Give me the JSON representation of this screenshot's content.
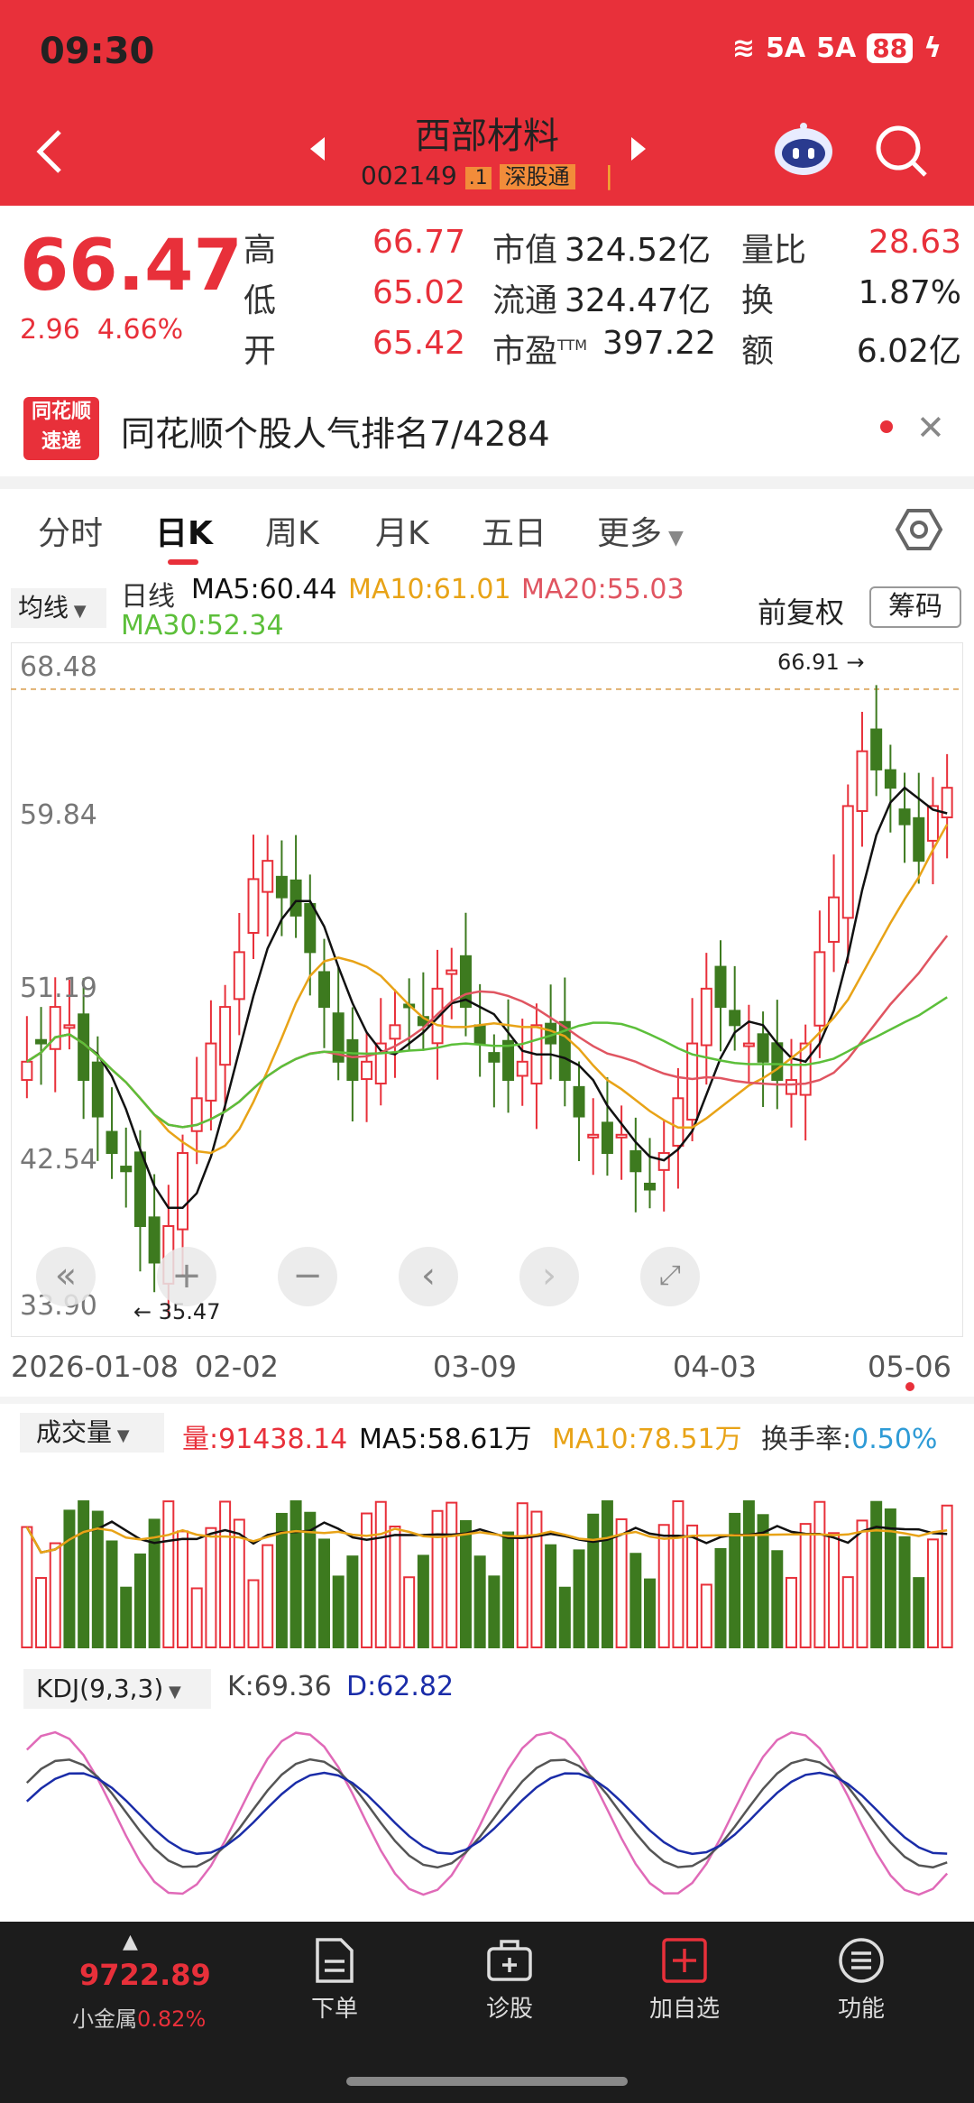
{
  "status": {
    "time": "09:30",
    "signal": "5A",
    "battery": "88"
  },
  "header": {
    "name": "西部材料",
    "code": "002149",
    "tag_level": ".1",
    "tag_exchange": "深股通"
  },
  "quote": {
    "price": "66.47",
    "change": "2.96",
    "change_pct": "4.66%",
    "high_label": "高",
    "high": "66.77",
    "low_label": "低",
    "low": "65.02",
    "open_label": "开",
    "open": "65.42",
    "mcap_label": "市值",
    "mcap": "324.52亿",
    "float_label": "流通",
    "float": "324.47亿",
    "pe_label": "市盈",
    "pe_sup": "TTM",
    "pe": "397.22",
    "vr_label": "量比",
    "vr": "28.63",
    "turnover_label": "换",
    "turnover": "1.87%",
    "amount_label": "额",
    "amount": "6.02亿"
  },
  "banner": {
    "logo_top": "同花顺",
    "logo_bottom": "速递",
    "text": "同花顺个股人气排名7/4284"
  },
  "tabs": [
    "分时",
    "日K",
    "周K",
    "月K",
    "五日",
    "更多"
  ],
  "kline": {
    "ma_select": "均线",
    "period": "日线",
    "ma5": "MA5:60.44",
    "ma10": "MA10:61.01",
    "ma20": "MA20:55.03",
    "ma30": "MA30:52.34",
    "adjust": "前复权",
    "chip": "筹码",
    "y_ticks": [
      "68.48",
      "59.84",
      "51.19",
      "42.54",
      "33.90"
    ],
    "x_ticks": [
      "2026-01-08",
      "02-02",
      "03-09",
      "04-03",
      "05-06"
    ],
    "max_label": "66.91",
    "min_label": "35.47"
  },
  "volume": {
    "select": "成交量",
    "vol": "量:91438.14",
    "ma5": "MA5:58.61万",
    "ma10": "MA10:78.51万",
    "turnover_label": "换手率:",
    "turnover": "0.50%"
  },
  "kdj": {
    "select": "KDJ(9,3,3)",
    "k": "K:69.36",
    "d": "D:62.82"
  },
  "bottom": {
    "index_value": "9722.89",
    "index_name": "小金属",
    "index_change": "0.82%",
    "items": [
      "下单",
      "诊股",
      "加自选",
      "功能"
    ]
  },
  "colors": {
    "up": "#e8303a",
    "down": "#3d7a1f",
    "ma5": "#111111",
    "ma10": "#e8a317",
    "ma20": "#e05561",
    "ma30": "#5cbf3a",
    "kdj_j": "#e06ab8",
    "kdj_d": "#1a2ca8"
  }
}
